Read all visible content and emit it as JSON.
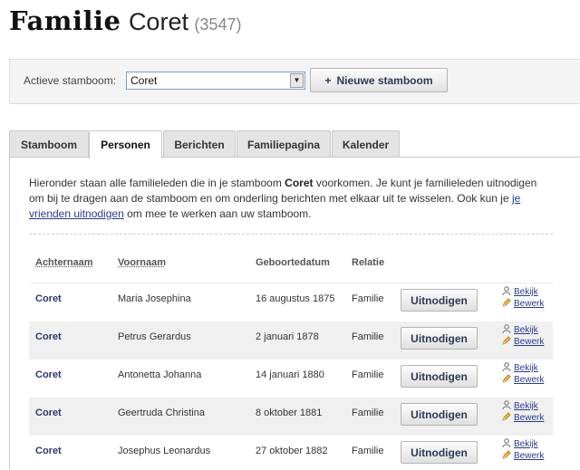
{
  "page": {
    "title_family": "Familie",
    "title_name": "Coret",
    "title_count": "(3547)"
  },
  "tree_bar": {
    "label": "Actieve stamboom:",
    "selected": "Coret",
    "new_button": "Nieuwe stamboom"
  },
  "tabs": [
    "Stamboom",
    "Personen",
    "Berichten",
    "Familiepagina",
    "Kalender"
  ],
  "active_tab": "Personen",
  "intro": {
    "part1": "Hieronder staan alle familieleden die in je stamboom ",
    "tree_name": "Coret",
    "part2": " voorkomen. Je kunt je familieleden uitnodigen om bij te dragen aan de stamboom en om onderling berichten met elkaar uit te wisselen. Ook kun je ",
    "link": "je vrienden uitnodigen",
    "part3": " om mee te werken aan uw stamboom."
  },
  "table": {
    "headers": {
      "surname": "Achternaam",
      "firstname": "Voornaam",
      "birthdate": "Geboortedatum",
      "relation": "Relatie"
    },
    "rows": [
      {
        "surname": "Coret",
        "firstname": "Maria Josephina",
        "birthdate": "16 augustus 1875",
        "relation": "Familie"
      },
      {
        "surname": "Coret",
        "firstname": "Petrus Gerardus",
        "birthdate": "2 januari 1878",
        "relation": "Familie"
      },
      {
        "surname": "Coret",
        "firstname": "Antonetta Johanna",
        "birthdate": "14 januari 1880",
        "relation": "Familie"
      },
      {
        "surname": "Coret",
        "firstname": "Geertruda Christina",
        "birthdate": "8 oktober 1881",
        "relation": "Familie"
      },
      {
        "surname": "Coret",
        "firstname": "Josephus Leonardus",
        "birthdate": "27 oktober 1882",
        "relation": "Familie"
      }
    ],
    "invite_label": "Uitnodigen",
    "view_label": "Bekijk",
    "edit_label": "Bewerk"
  },
  "icons": {
    "view": "person-icon",
    "edit": "pencil-icon",
    "select": "chevron-down-icon",
    "add": "plus-icon"
  },
  "colors": {
    "link": "#2a3a8c",
    "surname": "#2b3a6b",
    "button_text": "#2b3a55",
    "alt_row": "#f0f0f0"
  }
}
